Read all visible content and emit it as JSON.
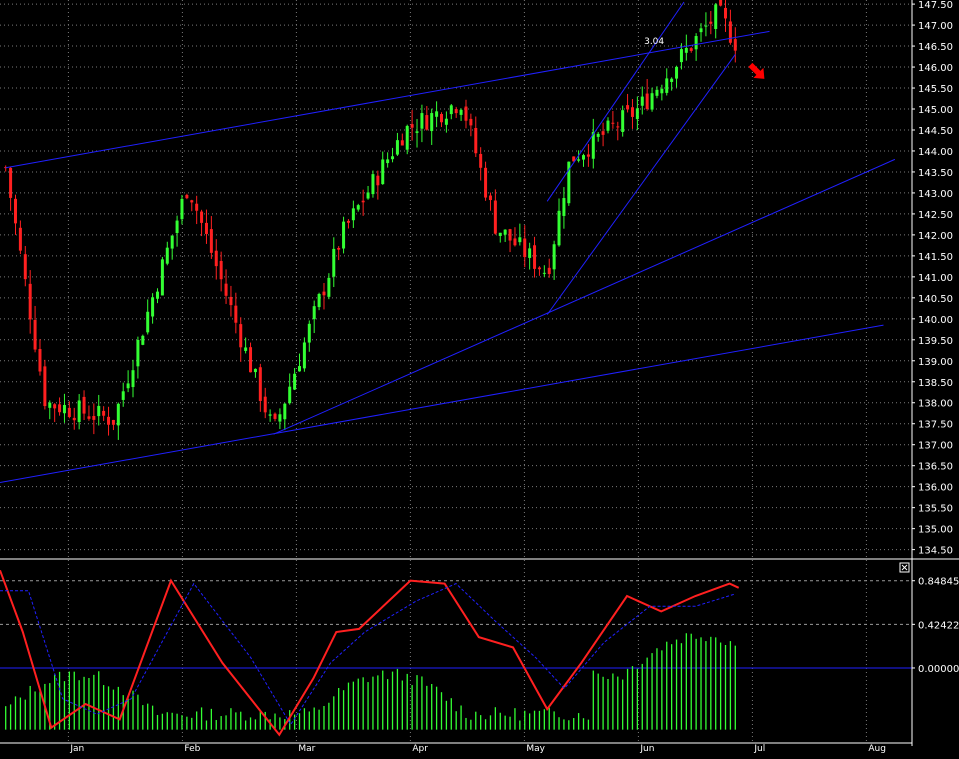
{
  "chart_data": [
    {
      "type": "candlestick",
      "panel": "price",
      "y_ticks": [
        "134.50",
        "135.00",
        "135.50",
        "136.00",
        "136.50",
        "137.00",
        "137.50",
        "138.00",
        "138.50",
        "139.00",
        "139.50",
        "140.00",
        "140.50",
        "141.00",
        "141.50",
        "142.00",
        "142.50",
        "143.00",
        "143.50",
        "144.00",
        "144.50",
        "145.00",
        "145.50",
        "146.00",
        "146.50",
        "147.00",
        "147.50"
      ],
      "ylim": [
        134.3,
        147.55
      ],
      "x_months": [
        "Jan",
        "Feb",
        "Mar",
        "Apr",
        "May",
        "Jun",
        "Jul",
        "Aug"
      ],
      "x_month_positions": [
        0.6,
        1.6,
        2.6,
        3.6,
        4.6,
        5.6,
        6.6,
        7.6
      ],
      "xlim": [
        0,
        8.0
      ],
      "key_points": [
        {
          "x": 0.05,
          "close": 143.6
        },
        {
          "x": 0.4,
          "close": 138.0
        },
        {
          "x": 1.0,
          "close": 137.6
        },
        {
          "x": 1.65,
          "close": 143.2
        },
        {
          "x": 2.4,
          "close": 137.3
        },
        {
          "x": 3.0,
          "close": 142.0
        },
        {
          "x": 3.55,
          "close": 144.5
        },
        {
          "x": 4.05,
          "close": 145.2
        },
        {
          "x": 4.35,
          "close": 142.2
        },
        {
          "x": 4.8,
          "close": 141.1
        },
        {
          "x": 5.0,
          "close": 143.8
        },
        {
          "x": 5.6,
          "close": 145.0
        },
        {
          "x": 6.3,
          "close": 147.3
        },
        {
          "x": 6.45,
          "close": 146.6
        }
      ],
      "annotation": "3.04",
      "colors": {
        "up": "#33ff33",
        "down": "#ff2020",
        "trendline": "#2020ff",
        "arrow": "#ff0000"
      }
    },
    {
      "type": "oscillator",
      "panel": "indicator",
      "y_ticks": [
        "0.84845",
        "0.42422",
        "0.00000"
      ],
      "ylim": [
        -0.72,
        1.05
      ],
      "series": [
        {
          "type": "line",
          "color": "#ff2020",
          "points": [
            [
              0.0,
              0.95
            ],
            [
              0.2,
              0.35
            ],
            [
              0.45,
              -0.58
            ],
            [
              0.75,
              -0.35
            ],
            [
              1.05,
              -0.5
            ],
            [
              1.5,
              0.85
            ],
            [
              1.95,
              0.05
            ],
            [
              2.45,
              -0.65
            ],
            [
              2.75,
              -0.1
            ],
            [
              2.95,
              0.35
            ],
            [
              3.15,
              0.38
            ],
            [
              3.6,
              0.85
            ],
            [
              3.9,
              0.82
            ],
            [
              4.2,
              0.3
            ],
            [
              4.5,
              0.2
            ],
            [
              4.8,
              -0.4
            ],
            [
              5.1,
              0.05
            ],
            [
              5.5,
              0.7
            ],
            [
              5.8,
              0.55
            ],
            [
              6.1,
              0.7
            ],
            [
              6.4,
              0.82
            ],
            [
              6.48,
              0.78
            ]
          ]
        },
        {
          "type": "signal",
          "color": "#2020ff",
          "points": [
            [
              0.0,
              0.75
            ],
            [
              0.25,
              0.75
            ],
            [
              0.55,
              -0.3
            ],
            [
              0.85,
              -0.45
            ],
            [
              1.15,
              -0.3
            ],
            [
              1.7,
              0.82
            ],
            [
              2.2,
              0.1
            ],
            [
              2.55,
              -0.55
            ],
            [
              2.9,
              0.05
            ],
            [
              3.2,
              0.35
            ],
            [
              3.65,
              0.65
            ],
            [
              4.0,
              0.82
            ],
            [
              4.35,
              0.45
            ],
            [
              4.7,
              0.1
            ],
            [
              4.95,
              -0.2
            ],
            [
              5.3,
              0.25
            ],
            [
              5.7,
              0.6
            ],
            [
              6.1,
              0.6
            ],
            [
              6.45,
              0.72
            ]
          ]
        }
      ],
      "histogram_color": "#33ff33"
    }
  ]
}
